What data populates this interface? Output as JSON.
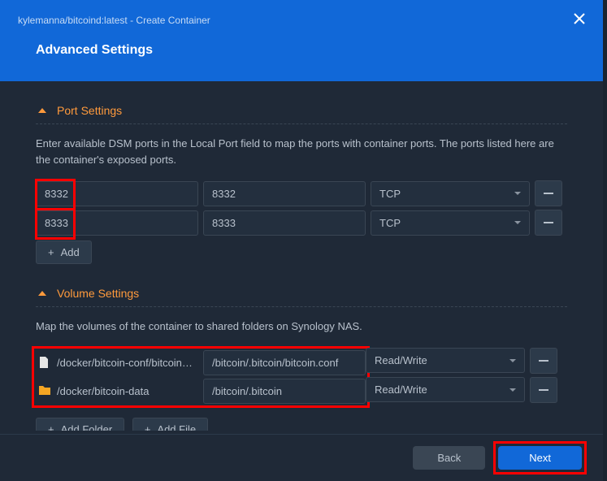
{
  "window": {
    "title": "kylemanna/bitcoind:latest - Create Container",
    "subtitle": "Advanced Settings"
  },
  "portSettings": {
    "title": "Port Settings",
    "description": "Enter available DSM ports in the Local Port field to map the ports with container ports. The ports listed here are the container's exposed ports.",
    "rows": [
      {
        "local": "8332",
        "container": "8332",
        "protocol": "TCP"
      },
      {
        "local": "8333",
        "container": "8333",
        "protocol": "TCP"
      }
    ],
    "addLabel": "Add"
  },
  "volumeSettings": {
    "title": "Volume Settings",
    "description": "Map the volumes of the container to shared folders on Synology NAS.",
    "rows": [
      {
        "type": "file",
        "host": "/docker/bitcoin-conf/bitcoin.c…",
        "mount": "/bitcoin/.bitcoin/bitcoin.conf",
        "mode": "Read/Write"
      },
      {
        "type": "folder",
        "host": "/docker/bitcoin-data",
        "mount": "/bitcoin/.bitcoin",
        "mode": "Read/Write"
      }
    ],
    "addFolderLabel": "Add Folder",
    "addFileLabel": "Add File"
  },
  "footer": {
    "back": "Back",
    "next": "Next"
  }
}
